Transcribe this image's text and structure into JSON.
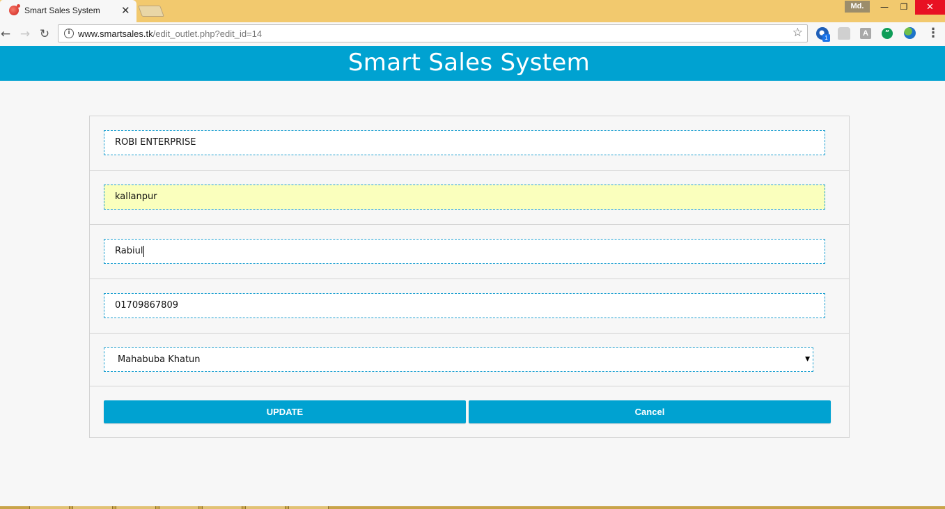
{
  "browser": {
    "tab_title": "Smart Sales System",
    "tab_close": "✕",
    "profile": "Md.",
    "url_host": "www.smartsales.tk",
    "url_path": "/edit_outlet.php?edit_id=14",
    "ext_badge": "1",
    "ext3_label": "A",
    "window_min": "—",
    "window_max": "❐",
    "window_close": "✕"
  },
  "header": {
    "title": "Smart Sales System"
  },
  "form": {
    "outlet_name": "ROBI ENTERPRISE",
    "address": "kallanpur",
    "owner_name": "Rabiul",
    "phone": "01709867809",
    "assigned_to": "Mahabuba Khatun",
    "update_label": "UPDATE",
    "cancel_label": "Cancel"
  },
  "colors": {
    "brand": "#00a2d1",
    "autofill": "#faffbd",
    "titlebar": "#f2c96e",
    "close": "#e81123"
  }
}
